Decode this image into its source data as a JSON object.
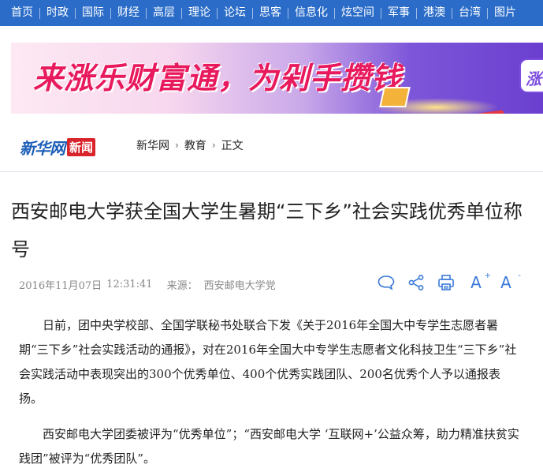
{
  "nav": {
    "items": [
      "首页",
      "时政",
      "国际",
      "财经",
      "高层",
      "理论",
      "论坛",
      "思客",
      "信息化",
      "炫空间",
      "军事",
      "港澳",
      "台湾",
      "图片"
    ]
  },
  "banner": {
    "text": "来涨乐财富通，为剁手攒钱",
    "app_logo_text": "涨"
  },
  "header": {
    "logo_main": "新华网",
    "logo_sub": "新闻",
    "breadcrumb": [
      "新华网",
      "教育",
      "正文"
    ]
  },
  "article": {
    "title": "西安邮电大学获全国大学生暑期“三下乡”社会实践优秀单位称号",
    "date": "2016年11月07日",
    "time": "12:31:41",
    "source_label": "来源：",
    "source": "西安邮电大学党",
    "tools": {
      "font_increase": "A",
      "font_increase_sup": "+",
      "font_decrease": "A",
      "font_decrease_sup": "-"
    },
    "paragraphs": [
      "日前，团中央学校部、全国学联秘书处联合下发《关于2016年全国大中专学生志愿者暑期“三下乡”社会实践活动的通报》，对在2016年全国大中专学生志愿者文化科技卫生“三下乡”社会实践活动中表现突出的300个优秀单位、400个优秀实践团队、200名优秀个人予以通报表扬。",
      "西安邮电大学团委被评为“优秀单位”；“西安邮电大学 ‘互联网+’公益众筹，助力精准扶贫实践团”被评为“优秀团队”。"
    ]
  },
  "colors": {
    "nav_bg": "#2a6cc8",
    "accent_blue": "#3a7ad8",
    "logo_red": "#d9242b",
    "banner_text": "#e8195d"
  },
  "icons": [
    "comment-icon",
    "share-icon",
    "print-icon",
    "font-increase-icon",
    "font-decrease-icon"
  ]
}
